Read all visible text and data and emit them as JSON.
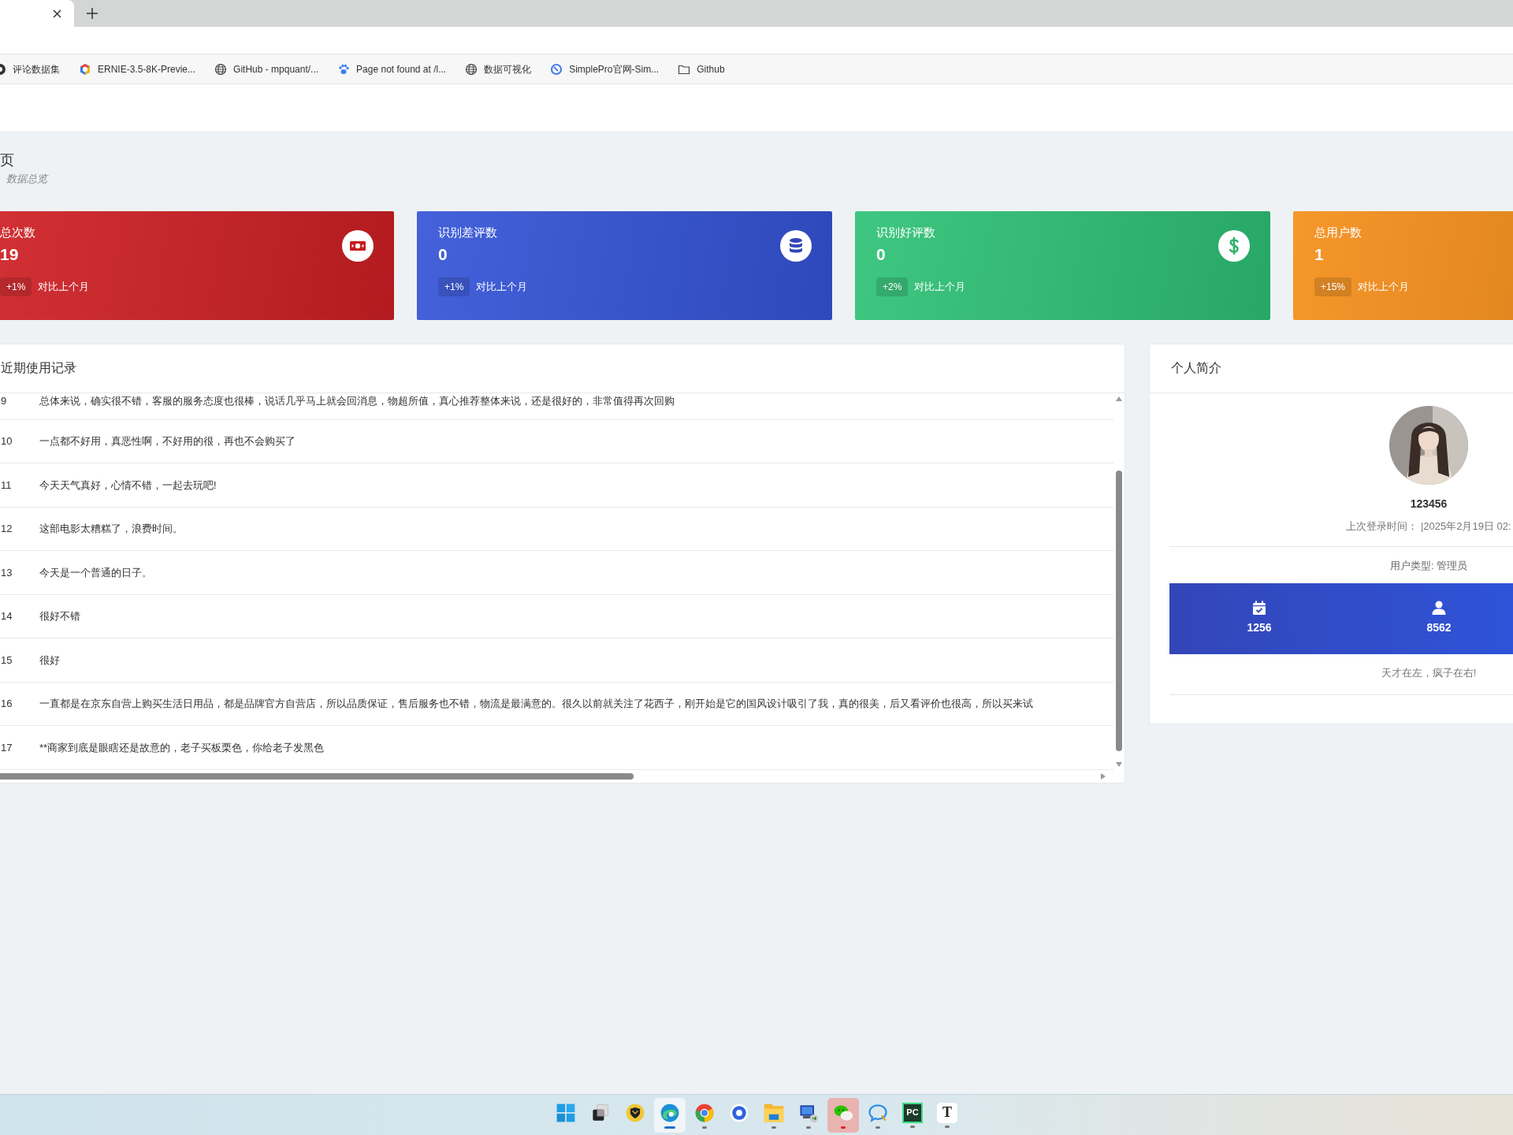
{
  "browser": {
    "bookmarks": [
      {
        "label": "评论数据集",
        "kind": "dark"
      },
      {
        "label": "ERNIE-3.5-8K-Previe...",
        "kind": "cube"
      },
      {
        "label": "GitHub - mpquant/...",
        "kind": "globe"
      },
      {
        "label": "Page not found at /l...",
        "kind": "paw"
      },
      {
        "label": "数据可视化",
        "kind": "globe"
      },
      {
        "label": "SimplePro官网-Sim...",
        "kind": "ring"
      },
      {
        "label": "Github",
        "kind": "folder"
      }
    ]
  },
  "page": {
    "title": "页",
    "subtitle": "数据总览"
  },
  "stats": [
    {
      "label": "总次数",
      "value": "19",
      "change": "+1%",
      "note": "对比上个月",
      "kind": "money",
      "color": "#cf1f24"
    },
    {
      "label": "识别差评数",
      "value": "0",
      "change": "+1%",
      "note": "对比上个月",
      "kind": "database",
      "color": "#3454d8"
    },
    {
      "label": "识别好评数",
      "value": "0",
      "change": "+2%",
      "note": "对比上个月",
      "kind": "dollar",
      "color": "#2ec276"
    },
    {
      "label": "总用户数",
      "value": "1",
      "change": "+15%",
      "note": "对比上个月",
      "color": "#f58e18"
    }
  ],
  "records": {
    "title": "近期使用记录",
    "rows": [
      {
        "no": "9",
        "text": "总体来说，确实很不错，客服的服务态度也很棒，说话几乎马上就会回消息，物超所值，真心推荐整体来说，还是很好的，非常值得再次回购"
      },
      {
        "no": "10",
        "text": "一点都不好用，真恶性啊，不好用的很，再也不会购买了"
      },
      {
        "no": "11",
        "text": "今天天气真好，心情不错，一起去玩吧!"
      },
      {
        "no": "12",
        "text": "这部电影太糟糕了，浪费时间。"
      },
      {
        "no": "13",
        "text": "今天是一个普通的日子。"
      },
      {
        "no": "14",
        "text": "很好不错"
      },
      {
        "no": "15",
        "text": "很好"
      },
      {
        "no": "16",
        "text": "一直都是在京东自营上购买生活日用品，都是品牌官方自营店，所以品质保证，售后服务也不错，物流是最满意的。很久以前就关注了花西子，刚开始是它的国风设计吸引了我，真的很美，后又看评价也很高，所以买来试"
      },
      {
        "no": "17",
        "text": "**商家到底是眼瞎还是故意的，老子买板栗色，你给老子发黑色"
      }
    ]
  },
  "profile": {
    "title": "个人简介",
    "name": "123456",
    "login": "上次登录时间： |2025年2月19日 02:",
    "role": "用户类型: 管理员",
    "stats": [
      {
        "kind": "calendar",
        "value": "1256"
      },
      {
        "kind": "user",
        "value": "8562"
      }
    ],
    "motto": "天才在左，疯子在右!"
  },
  "taskbar": [
    {
      "kind": "start",
      "running": false,
      "active": false,
      "attention": false
    },
    {
      "kind": "taskview",
      "running": false,
      "active": false,
      "attention": false
    },
    {
      "kind": "shield",
      "running": false,
      "active": false,
      "attention": false
    },
    {
      "kind": "edge",
      "running": true,
      "active": true,
      "attention": false
    },
    {
      "kind": "chrome",
      "running": true,
      "active": false,
      "attention": false
    },
    {
      "kind": "ring",
      "running": false,
      "active": false,
      "attention": false
    },
    {
      "kind": "folder",
      "running": true,
      "active": false,
      "attention": false
    },
    {
      "kind": "computer",
      "running": true,
      "active": false,
      "attention": false
    },
    {
      "kind": "wechat",
      "running": true,
      "active": false,
      "attention": true
    },
    {
      "kind": "chat",
      "running": true,
      "active": false,
      "attention": false
    },
    {
      "kind": "tile",
      "label": "PC",
      "running": true,
      "active": false,
      "attention": false
    },
    {
      "kind": "letter",
      "label": "T",
      "running": true,
      "active": false,
      "attention": false
    }
  ]
}
